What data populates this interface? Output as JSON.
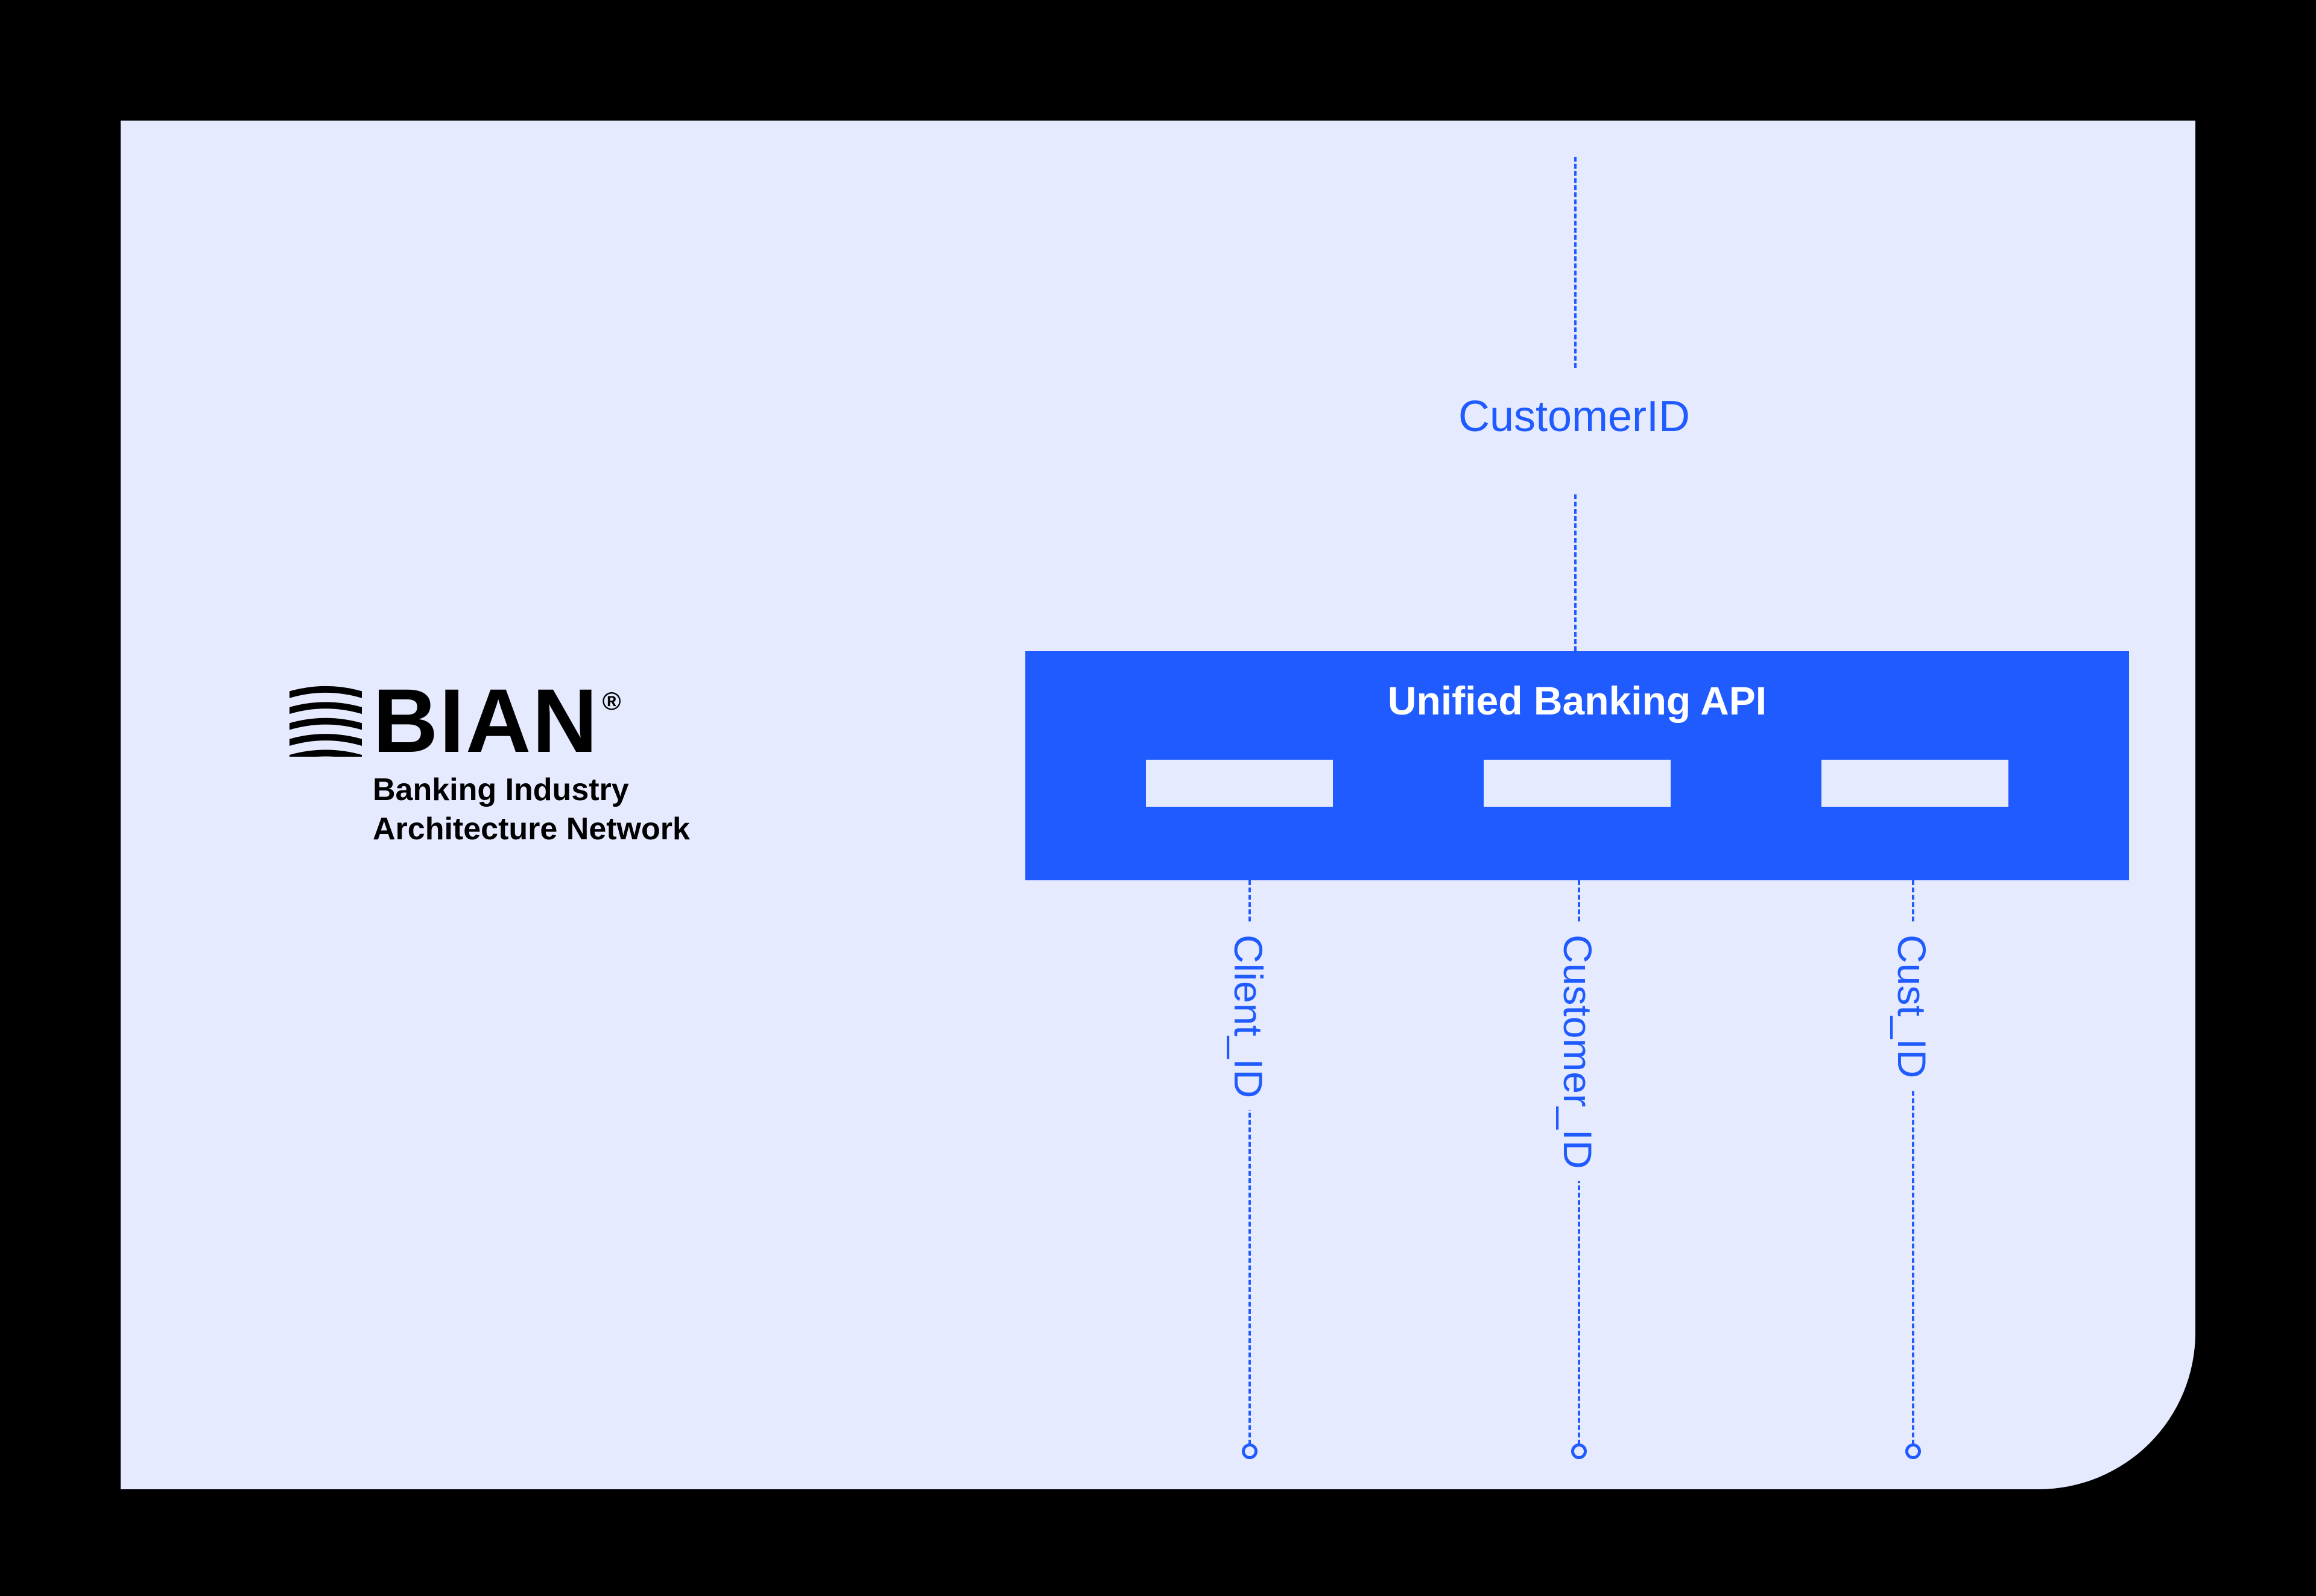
{
  "logo": {
    "word": "BIAN",
    "registered": "®",
    "subtitle_line1": "Banking Industry",
    "subtitle_line2": "Architecture Network"
  },
  "top_label": "CustomerID",
  "api_box": {
    "title": "Unified Banking API"
  },
  "columns": [
    {
      "label": "Client_ID"
    },
    {
      "label": "Customer_ID"
    },
    {
      "label": "Cust_ID"
    }
  ]
}
